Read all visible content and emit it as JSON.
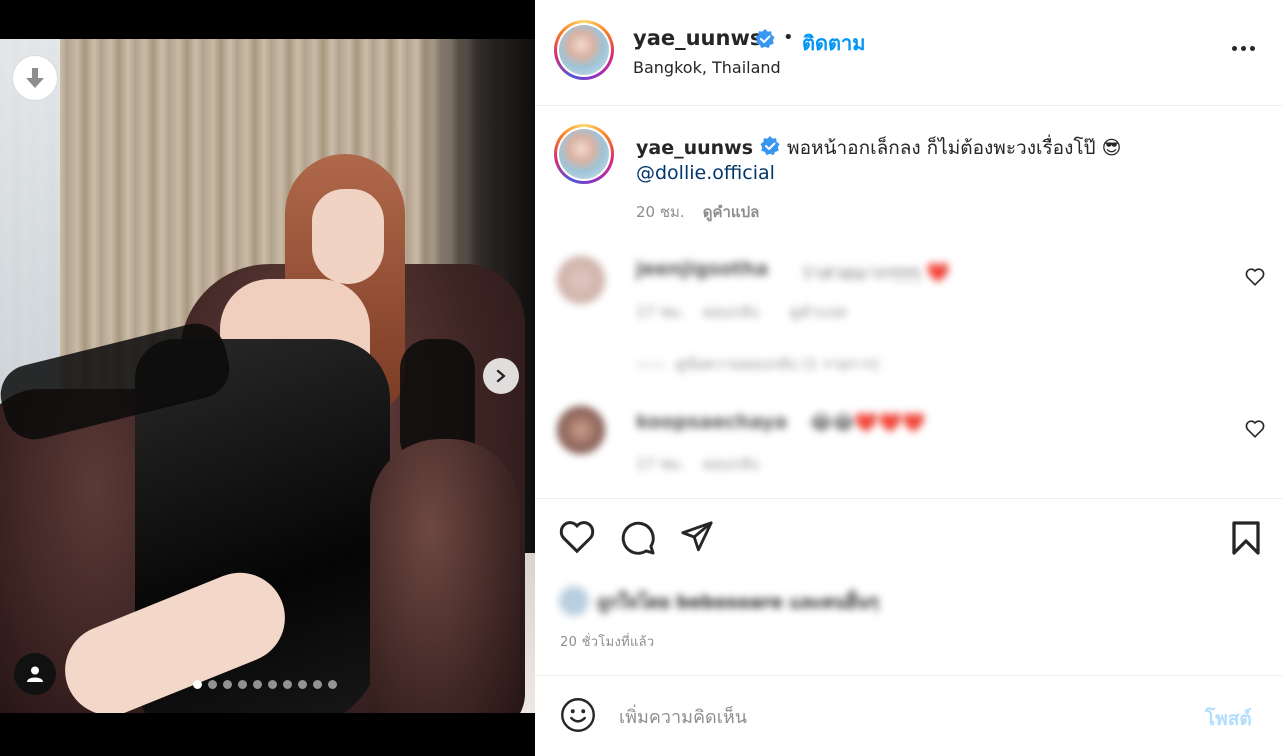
{
  "post": {
    "username": "yae_uunws",
    "separator": "•",
    "follow_label": "ติดตาม",
    "location": "Bangkok, Thailand",
    "caption_text": "พอหน้าอกเล็กลง ก็ไม่ต้องพะวงเรื่องโป๊ 😎",
    "mention": "@dollie.official",
    "caption_time": "20 ชม.",
    "translate_label": "ดูคำแปล"
  },
  "comments": [
    {
      "username": "jeenjigsotha",
      "text": "ว่าสวยมากๆๆๆ ❤️",
      "time": "17 ชม.",
      "reply": "ตอบกลับ",
      "extra": "ดูคำแปล",
      "view_replies": "ดูข้อความตอบกลับ (1 รายการ)"
    },
    {
      "username": "koopsaechaya",
      "text": "😂😂❤️❤️❤️",
      "time": "17 ชม.",
      "reply": "ตอบกลับ"
    }
  ],
  "engagement": {
    "likes_text": "ถูกใจโดย bebosoare และคนอื่นๆ",
    "time_ago": "20 ชั่วโมงที่แล้ว"
  },
  "composer": {
    "placeholder": "เพิ่มความคิดเห็น",
    "post_label": "โพสต์"
  },
  "carousel": {
    "total": 10,
    "active_index": 1
  },
  "colors": {
    "accent": "#0095f6",
    "verified": "#3897f0",
    "post_disabled": "#b2dffc"
  }
}
